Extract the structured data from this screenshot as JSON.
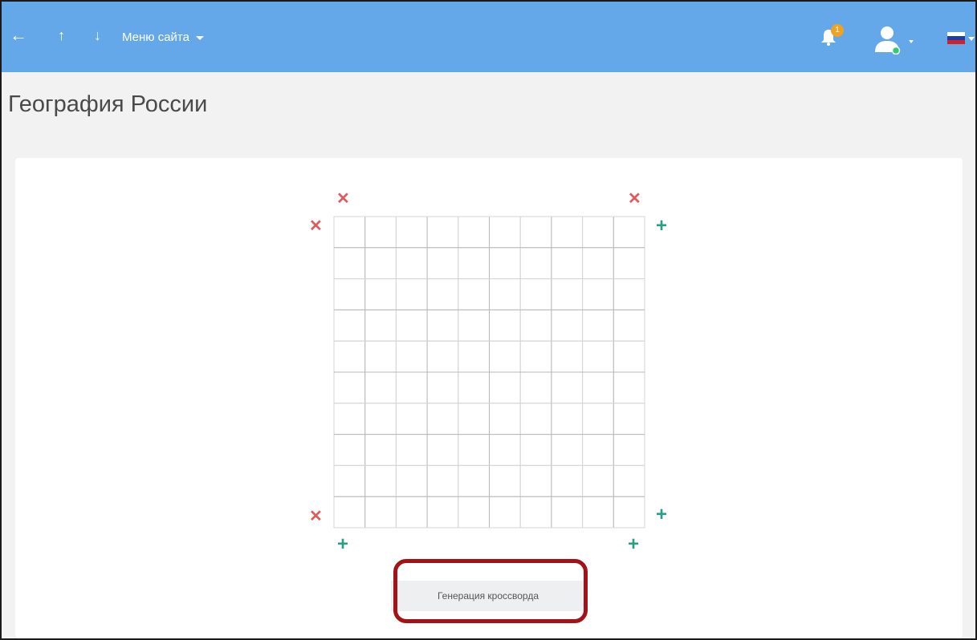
{
  "topbar": {
    "menu_label": "Меню сайта",
    "notification_count": "1",
    "bg_color": "#64a8ea"
  },
  "icons": [
    "back-arrow-icon",
    "arrow-up-icon",
    "arrow-down-icon",
    "chevron-down-icon",
    "bell-icon",
    "user-avatar-icon",
    "russian-flag-icon",
    "close-icon",
    "plus-icon"
  ],
  "page": {
    "title": "География России"
  },
  "crossword": {
    "rows": 10,
    "cols": 10,
    "remove_color": "#e15a5a",
    "add_color": "#2a9d85",
    "remove_symbol": "✕",
    "add_symbol": "+",
    "generate_label": "Генерация кроссворда"
  },
  "highlight_color": "#a31217"
}
